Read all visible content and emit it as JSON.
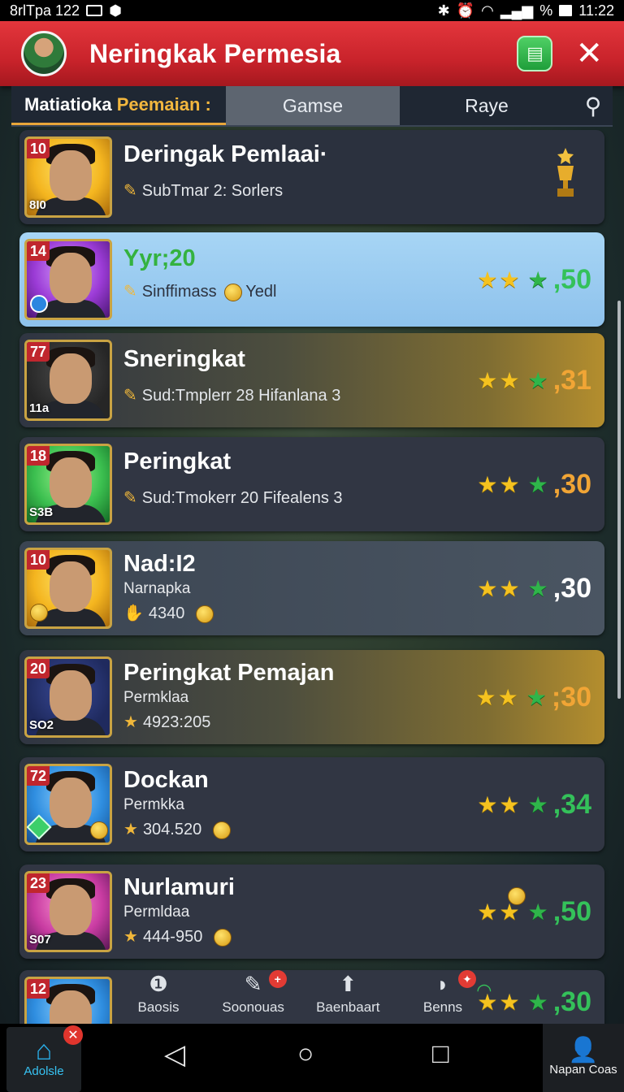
{
  "status_bar": {
    "left_text": "8rlТpa 122",
    "time": "11:22",
    "percent": "%"
  },
  "header": {
    "title": "Neringkak Permesia"
  },
  "tabs": {
    "active_label": "Matiatioka",
    "active_accent": "Peemaian :",
    "games": "Gamse",
    "raye": "Raye"
  },
  "rows": [
    {
      "rank": "10",
      "code": "8I0",
      "name": "Deringak Pemlaai·",
      "sub": "SubTmar 2: Sorlers",
      "score": ""
    },
    {
      "rank": "14",
      "code": "",
      "name": "Yyr;20",
      "sub": "Sinffimass",
      "sub2": "Yedl",
      "score": ",50"
    },
    {
      "rank": "77",
      "code": "11a",
      "name": "Sneringkat",
      "sub": "Sud:Tmplerr 28 Hifanlana 3",
      "score": ",31"
    },
    {
      "rank": "18",
      "code": "S3B",
      "name": "Peringkat",
      "sub": "Sud:Tmokerr 20 Fifealens 3",
      "score": ",30"
    },
    {
      "rank": "10",
      "code": "",
      "name": "Nad:I2",
      "label": "Narnapka",
      "sub": "4340",
      "score": ",30"
    },
    {
      "rank": "20",
      "code": "SO2",
      "name": "Peringkat Pemajan",
      "label": "Permklaa",
      "sub": "4923:205",
      "score": ";30"
    },
    {
      "rank": "72",
      "code": "",
      "name": "Dockan",
      "label": "Permkka",
      "sub": "304.520",
      "score": ",34"
    },
    {
      "rank": "23",
      "code": "S07",
      "name": "Nurlamuri",
      "label": "Permldaa",
      "sub": "444-950",
      "score": ",50"
    },
    {
      "rank": "12",
      "code": "",
      "name": "",
      "sub": "",
      "score": ",30"
    }
  ],
  "bottom_tabs": [
    "Baosis",
    "Soonouas",
    "Baenbaart",
    "Benns"
  ],
  "navbar": {
    "home_label": "Adolsle",
    "profile_label": "Napan Coas"
  },
  "colors": {
    "header_red": "#d42a31",
    "highlight_blue": "#9ccbf0",
    "gold": "#f1a535",
    "score_green": "#34c15a"
  }
}
